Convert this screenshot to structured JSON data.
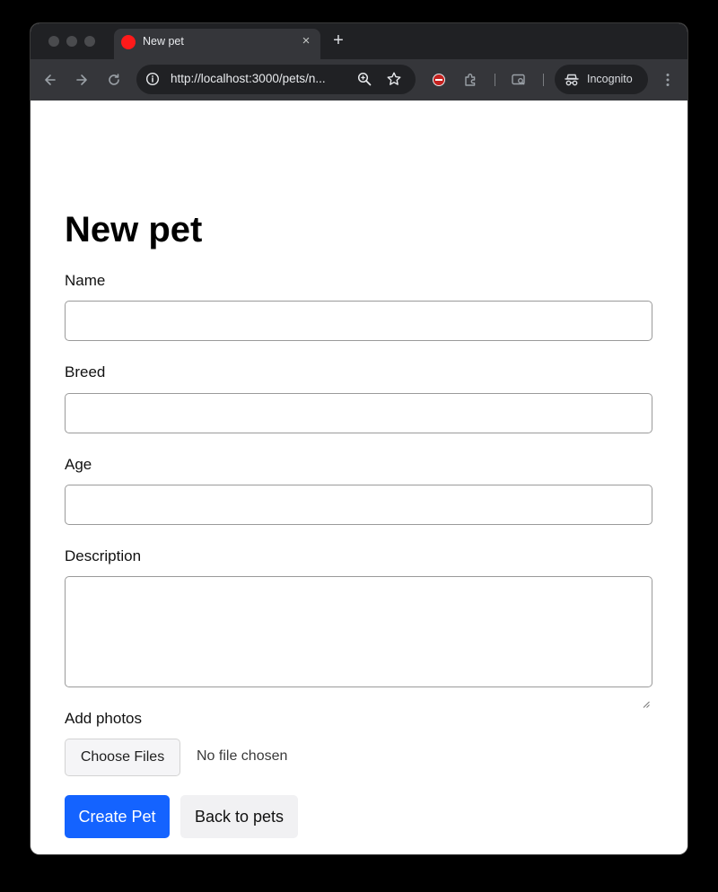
{
  "browser": {
    "tab": {
      "title": "New pet",
      "favicon_color": "#ff1a1a"
    },
    "address_bar": {
      "url": "http://localhost:3000/pets/n..."
    },
    "profile": {
      "label": "Incognito"
    },
    "icons": {
      "back": "arrow-left-icon",
      "forward": "arrow-right-icon",
      "reload": "reload-icon",
      "site_info": "info-icon",
      "zoom": "zoom-in-icon",
      "bookmark": "star-icon",
      "blocker": "block-icon",
      "extensions": "puzzle-icon",
      "tab_search": "tab-search-icon",
      "menu": "vertical-dots-icon"
    }
  },
  "form": {
    "title": "New pet",
    "fields": {
      "name": {
        "label": "Name",
        "value": ""
      },
      "breed": {
        "label": "Breed",
        "value": ""
      },
      "age": {
        "label": "Age",
        "value": ""
      },
      "description": {
        "label": "Description",
        "value": ""
      }
    },
    "photos": {
      "label": "Add photos",
      "button_label": "Choose Files",
      "status": "No file chosen"
    },
    "actions": {
      "submit_label": "Create Pet",
      "back_label": "Back to pets"
    }
  },
  "colors": {
    "primary_button": "#1463ff",
    "secondary_button": "#f1f1f3",
    "browser_frame": "#35363a",
    "tab_strip": "#202124"
  }
}
